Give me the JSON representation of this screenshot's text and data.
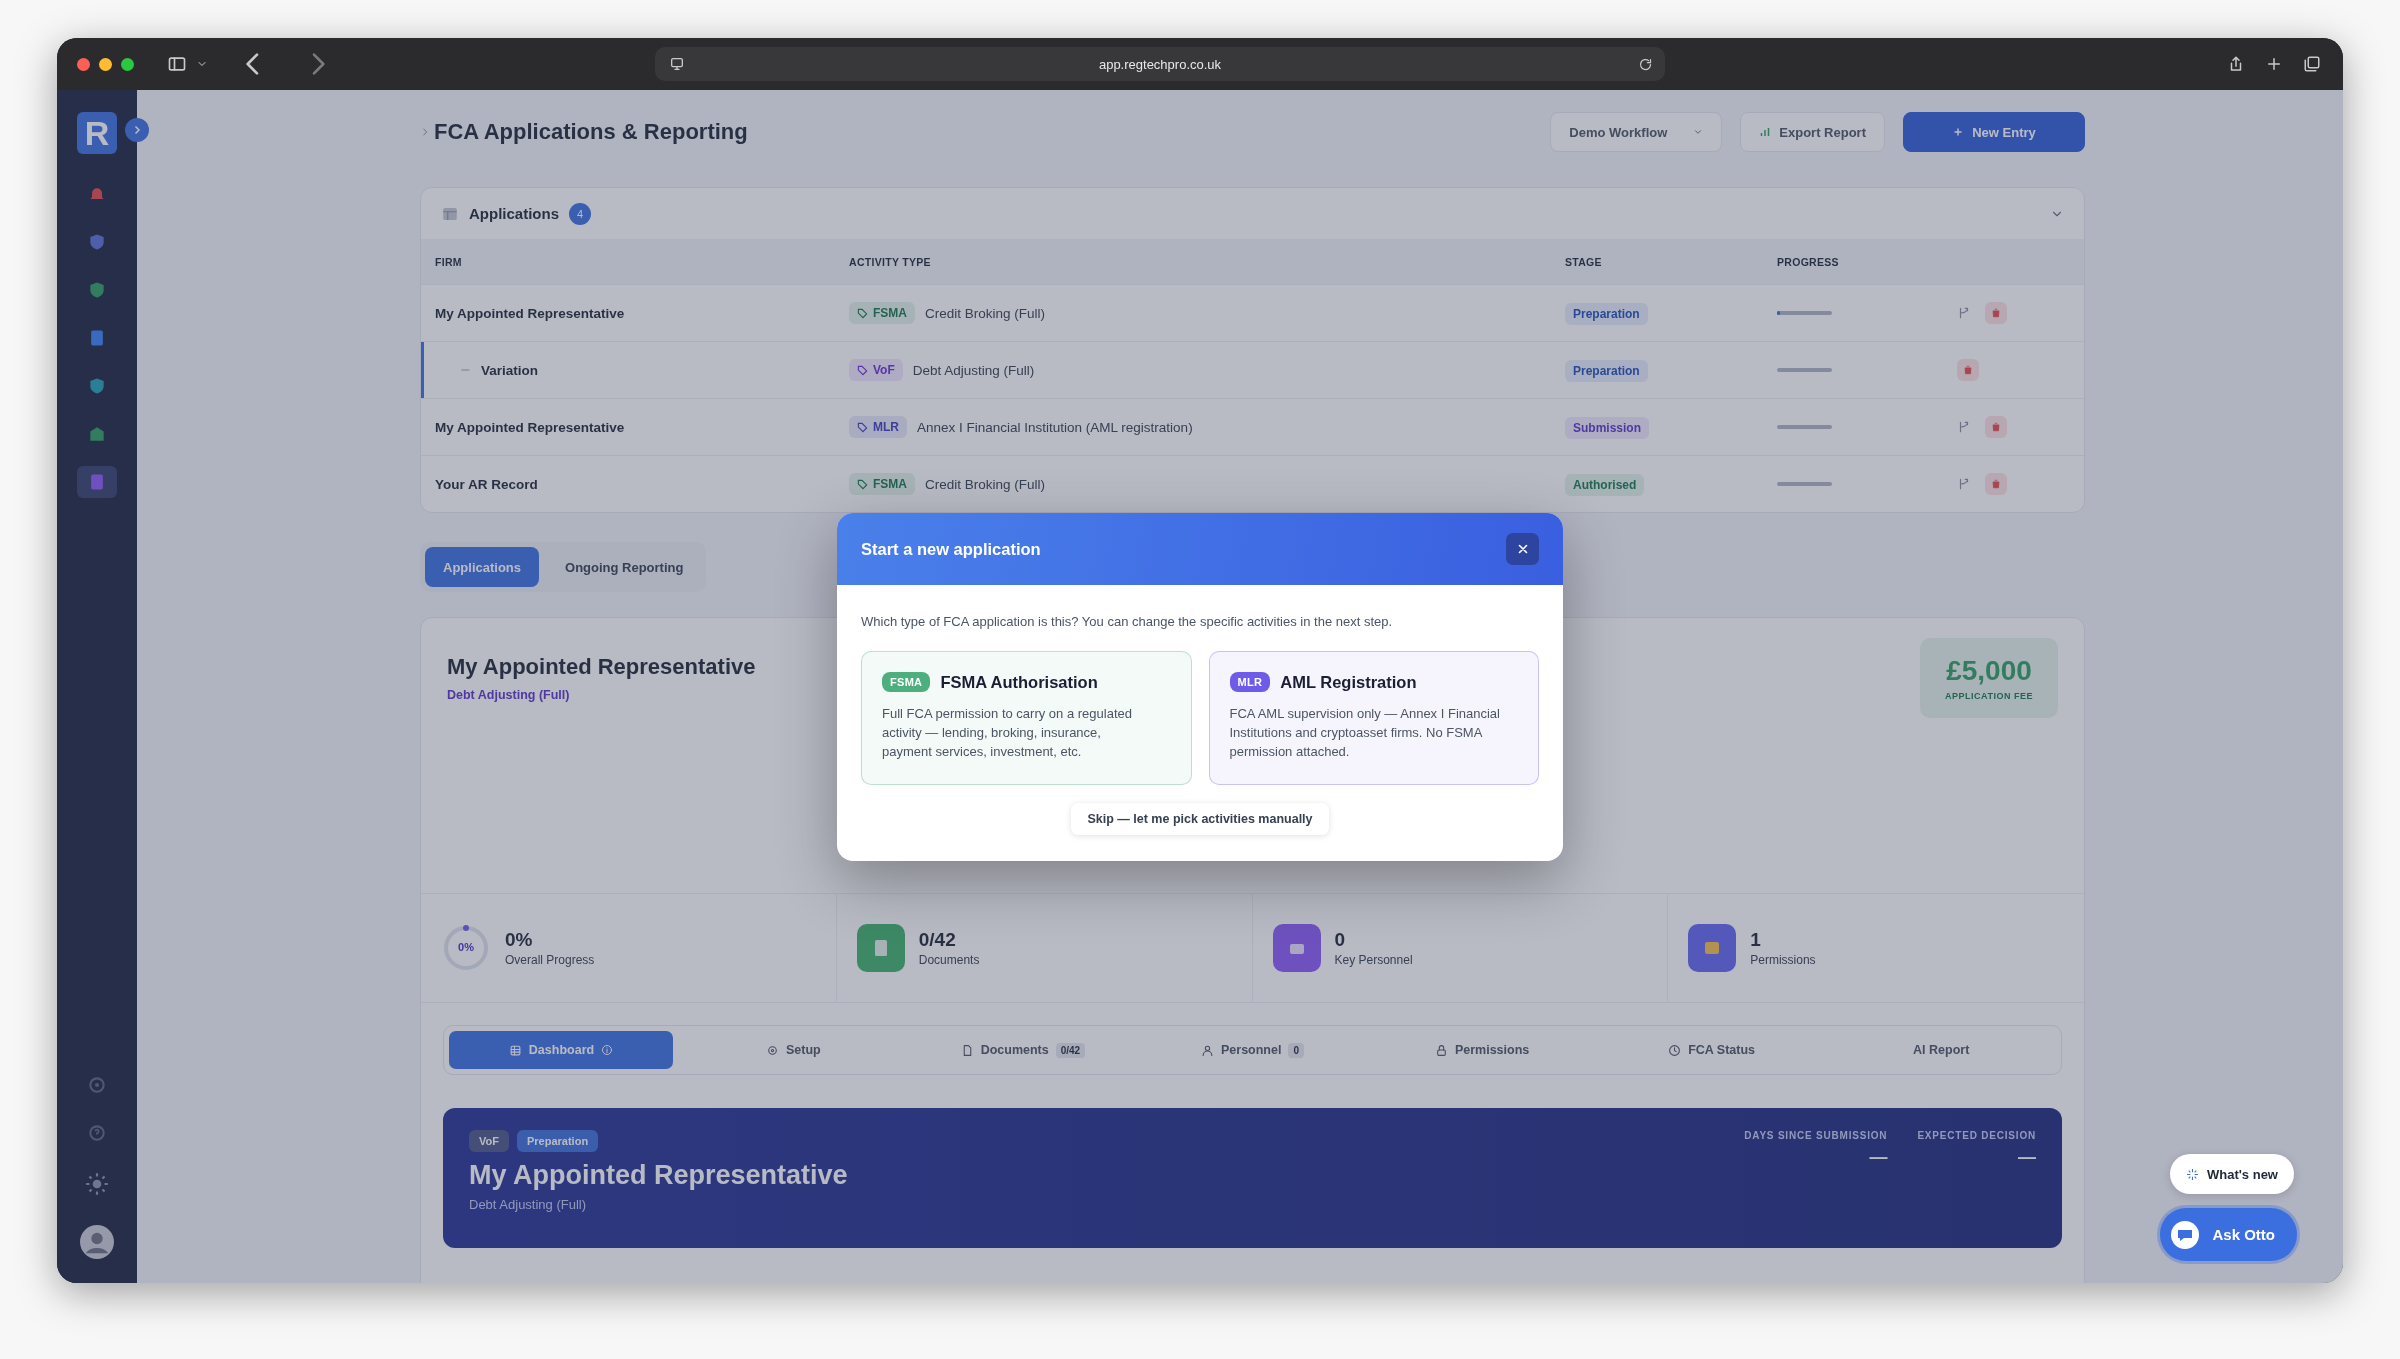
{
  "browser": {
    "url": "app.regtechpro.co.uk"
  },
  "sidebar": {
    "logo": "R",
    "items": [
      {
        "selected": false
      },
      {
        "selected": false
      },
      {
        "selected": false
      },
      {
        "selected": false
      },
      {
        "selected": false
      },
      {
        "selected": false
      },
      {
        "selected": true
      }
    ]
  },
  "header": {
    "title": "FCA Applications & Reporting",
    "workflow": "Demo Workflow",
    "export": "Export Report",
    "new_entry": "New Entry"
  },
  "applications": {
    "title": "Applications",
    "count": "4",
    "columns": [
      "FIRM",
      "ACTIVITY TYPE",
      "STAGE",
      "PROGRESS"
    ],
    "rows": [
      {
        "firm": "My Appointed Representative",
        "tag": {
          "label": "FSMA",
          "kind": "fsma"
        },
        "activity": "Credit Broking (Full)",
        "stage": {
          "label": "Preparation",
          "kind": "preparation"
        },
        "level": 0.05,
        "children": [
          {
            "firm": "Variation",
            "tag": {
              "label": "VoF",
              "kind": "vof"
            },
            "activity": "Debt Adjusting (Full)",
            "stage": {
              "label": "Preparation",
              "kind": "preparation"
            },
            "level": 0
          }
        ]
      },
      {
        "firm": "My Appointed Representative",
        "tag": {
          "label": "MLR",
          "kind": "mlr"
        },
        "activity": "Annex I Financial Institution (AML registration)",
        "stage": {
          "label": "Submission",
          "kind": "submission"
        },
        "level": 0
      },
      {
        "firm": "Your AR Record",
        "tag": {
          "label": "FSMA",
          "kind": "fsma"
        },
        "activity": "Credit Broking (Full)",
        "stage": {
          "label": "Authorised",
          "kind": "authorised"
        },
        "level": 0
      }
    ]
  },
  "view_tabs": [
    {
      "label": "Applications",
      "selected": true
    },
    {
      "label": "Ongoing Reporting",
      "selected": false
    }
  ],
  "summary": {
    "firm": "My Appointed Representative",
    "activity": "Debt Adjusting (Full)",
    "fee": "£5,000",
    "fee_label": "APPLICATION FEE"
  },
  "stats": [
    {
      "kind": "ring",
      "ring_text": "0%",
      "level": 0,
      "value": "0%",
      "label": "Overall Progress"
    },
    {
      "kind": "document",
      "value": "0/42",
      "label": "Documents"
    },
    {
      "kind": "people",
      "value": "0",
      "label": "Key Personnel"
    },
    {
      "kind": "permit",
      "value": "1",
      "label": "Permissions"
    }
  ],
  "section_tabs": [
    {
      "label": "Dashboard",
      "selected": true
    },
    {
      "label": "Setup",
      "selected": false
    },
    {
      "label": "Documents",
      "count": "0/42",
      "selected": false
    },
    {
      "label": "Personnel",
      "count": "0",
      "selected": false
    },
    {
      "label": "Permissions",
      "selected": false
    },
    {
      "label": "FCA Status",
      "selected": false
    },
    {
      "label": "AI Report",
      "selected": false
    }
  ],
  "banner": {
    "badges": [
      {
        "label": "VoF",
        "kind": "activity"
      },
      {
        "label": "Preparation",
        "kind": "stage"
      }
    ],
    "title": "My Appointed Representative",
    "subtitle": "Debt Adjusting (Full)",
    "metrics": [
      {
        "label": "DAYS SINCE SUBMISSION",
        "value": "—"
      },
      {
        "label": "EXPECTED DECISION",
        "value": "—"
      }
    ]
  },
  "modal": {
    "title": "Start a new application",
    "prompt": "Which type of FCA application is this? You can change the specific activities in the next step.",
    "options": [
      {
        "tag": "FSMA",
        "title": "FSMA Authorisation",
        "description": "Full FCA permission to carry on a regulated activity — lending, broking, insurance, payment services, investment, etc.",
        "color": "#4caf7d"
      },
      {
        "tag": "MLR",
        "title": "AML Registration",
        "description": "FCA AML supervision only — Annex I Financial Institutions and cryptoasset firms. No FSMA permission attached.",
        "color": "#6d5ce8"
      }
    ],
    "skip": "Skip — let me pick activities manually"
  },
  "floating": {
    "whats_new": "What's new",
    "assistant": "Ask Otto"
  }
}
